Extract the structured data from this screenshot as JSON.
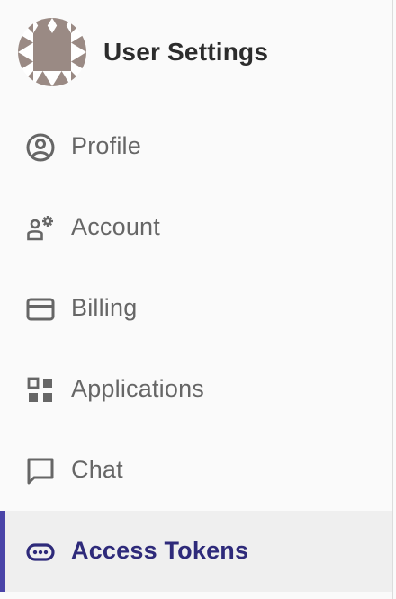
{
  "header": {
    "title": "User Settings",
    "avatar_icon": "identicon-avatar"
  },
  "nav": {
    "items": [
      {
        "label": "Profile",
        "icon": "profile-icon",
        "active": false
      },
      {
        "label": "Account",
        "icon": "account-icon",
        "active": false
      },
      {
        "label": "Billing",
        "icon": "credit-card-icon",
        "active": false
      },
      {
        "label": "Applications",
        "icon": "applications-icon",
        "active": false
      },
      {
        "label": "Chat",
        "icon": "chat-icon",
        "active": false
      },
      {
        "label": "Access Tokens",
        "icon": "token-icon",
        "active": true
      }
    ]
  },
  "colors": {
    "accent": "#4a44a8",
    "active_text": "#2e2a7a",
    "text": "#666666",
    "title": "#2c2c2c",
    "avatar": "#9a8a84"
  }
}
